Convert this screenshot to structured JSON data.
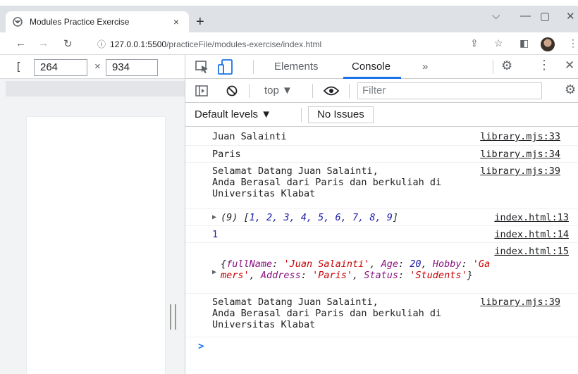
{
  "browser": {
    "tab_title": "Modules Practice Exercise",
    "tab_close": "×",
    "new_tab": "+",
    "win_min": "—",
    "win_max": "▢",
    "win_close": "✕",
    "win_dropdown": "⌵"
  },
  "omnibar": {
    "url_host": "127.0.0.1:5500",
    "url_path": "/practiceFile/modules-exercise/index.html"
  },
  "device_toolbar": {
    "bracket": "[",
    "width": "264",
    "times": "×",
    "height": "934"
  },
  "devtools": {
    "tabs": {
      "elements": "Elements",
      "console": "Console",
      "more": "»"
    },
    "toolbar": {
      "context": "top ▼",
      "filter_placeholder": "Filter"
    },
    "levels": {
      "label": "Default levels ▼",
      "issues": "No Issues"
    }
  },
  "console": {
    "rows": [
      {
        "msg": "Juan Salainti",
        "src": "library.mjs:33"
      },
      {
        "msg": "Paris",
        "src": "library.mjs:34"
      },
      {
        "msg": "Selamat Datang Juan Salainti,\nAnda Berasal dari Paris dan berkuliah di\nUniversitas Klabat",
        "src": "library.mjs:39"
      },
      {
        "msg_prefix": "(9) [",
        "msg_array": "1, 2, 3, 4, 5, 6, 7, 8, 9",
        "msg_suffix": "]",
        "src": "index.html:13"
      },
      {
        "msg": "1",
        "src": "index.html:14"
      },
      {
        "src": "index.html:15"
      },
      {
        "msg": "Selamat Datang Juan Salainti,\nAnda Berasal dari Paris dan berkuliah di\nUniversitas Klabat",
        "src": "library.mjs:39"
      }
    ],
    "object": {
      "k1": "fullName",
      "v1": "'Juan Salainti'",
      "k2": "Age",
      "v2": "20",
      "k3": "Hobby",
      "v3a": "'Ga",
      "v3b": "mers'",
      "k4": "Address",
      "v4": "'Paris'",
      "k5": "Status",
      "v5": "'Students'"
    },
    "prompt": ">"
  }
}
